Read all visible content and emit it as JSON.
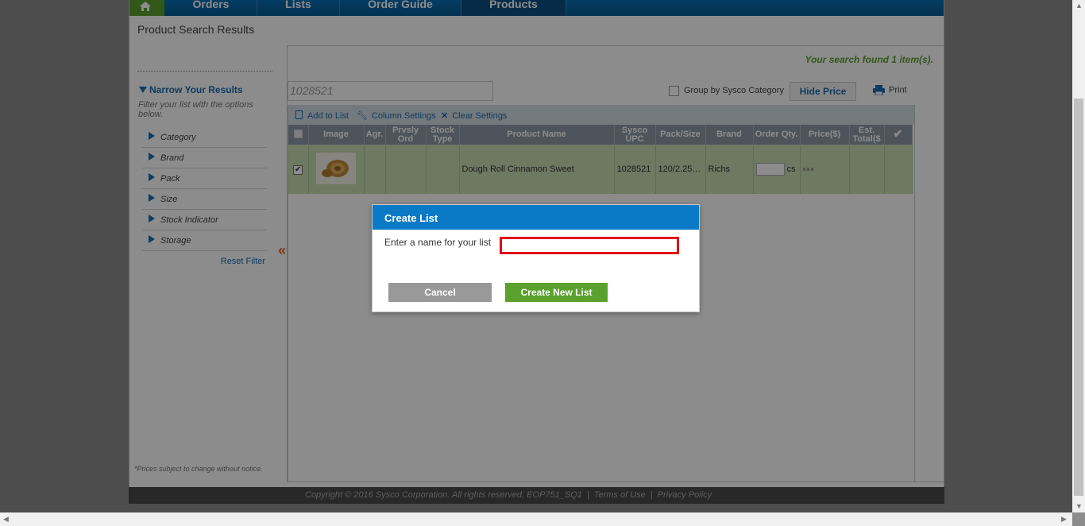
{
  "nav": {
    "home_icon": "home-icon",
    "items": [
      "Orders",
      "Lists",
      "Order Guide",
      "Products"
    ],
    "active": "Products"
  },
  "page": {
    "title": "Product Search Results"
  },
  "sidebar": {
    "narrow_title": "Narrow Your Results",
    "narrow_desc": "Filter your list with the options below.",
    "filters": [
      "Category",
      "Brand",
      "Pack",
      "Size",
      "Stock Indicator",
      "Storage"
    ],
    "reset_label": "Reset Filter",
    "prices_note": "*Prices subject to change without notice.",
    "collapse_glyph": "«"
  },
  "results": {
    "found_text": "Your search found 1 item(s).",
    "search_value": "1028521",
    "group_by_label": "Group by Sysco Category",
    "hide_price_label": "Hide Price",
    "print_label": "Print",
    "toolbar": {
      "add_to_list": "Add to List",
      "column_settings": "Column Settings",
      "clear_settings": "Clear Settings"
    },
    "columns": [
      "",
      "Image",
      "Agr.",
      "Prvsly Ord",
      "Stock Type",
      "Product Name",
      "Sysco UPC",
      "Pack/Size",
      "Brand",
      "Order Qty.",
      "Price($)",
      "Est. Total($",
      ""
    ],
    "rows": [
      {
        "checked": true,
        "agr": "",
        "prvsly_ord": "",
        "stock_type": "",
        "product_name": "Dough Roll Cinnamon Sweet",
        "upc": "1028521",
        "pack_size": "120/2.25…",
        "brand": "Richs",
        "order_qty_unit": "cs",
        "est_total": ""
      }
    ]
  },
  "modal": {
    "title": "Create List",
    "label": "Enter a name for your list",
    "input_value": "",
    "cancel_label": "Cancel",
    "create_label": "Create New List"
  },
  "footer": {
    "copyright": "Copyright © 2016 Sysco Corporation. All rights reserved. EOP751_SQ1",
    "terms": "Terms of Use",
    "privacy": "Privacy Policy",
    "separator": "|"
  },
  "colors": {
    "nav_blue": "#055a96",
    "home_green": "#5aa12e",
    "modal_header": "#0a7ac7",
    "input_error": "#e0001a",
    "row_green": "#c6ddb0"
  }
}
